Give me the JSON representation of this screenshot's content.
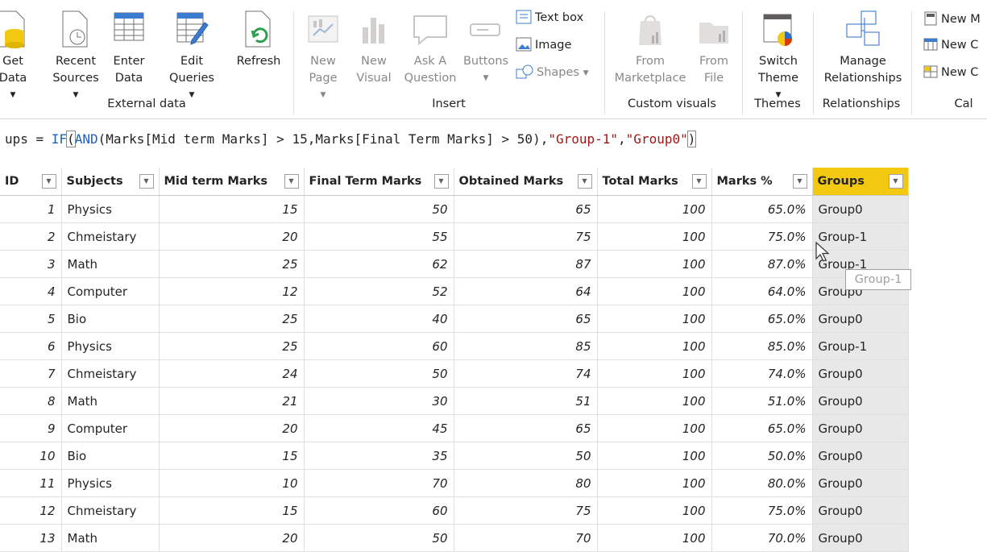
{
  "ribbon": {
    "external_data": {
      "group_label": "External data",
      "buttons": [
        {
          "line1": "Get",
          "line2": "Data"
        },
        {
          "line1": "Recent",
          "line2": "Sources"
        },
        {
          "line1": "Enter",
          "line2": "Data"
        },
        {
          "line1": "Edit",
          "line2": "Queries"
        },
        {
          "line1": "Refresh",
          "line2": ""
        }
      ]
    },
    "insert": {
      "group_label": "Insert",
      "buttons": [
        {
          "line1": "New",
          "line2": "Page"
        },
        {
          "line1": "New",
          "line2": "Visual"
        },
        {
          "line1": "Ask A",
          "line2": "Question"
        },
        {
          "line1": "Buttons",
          "line2": ""
        }
      ],
      "small": {
        "text_box": "Text box",
        "image": "Image",
        "shapes": "Shapes"
      }
    },
    "custom_visuals": {
      "group_label": "Custom visuals",
      "buttons": [
        {
          "line1": "From",
          "line2": "Marketplace"
        },
        {
          "line1": "From",
          "line2": "File"
        }
      ]
    },
    "themes": {
      "group_label": "Themes",
      "buttons": [
        {
          "line1": "Switch",
          "line2": "Theme"
        }
      ]
    },
    "relationships": {
      "group_label": "Relationships",
      "buttons": [
        {
          "line1": "Manage",
          "line2": "Relationships"
        }
      ]
    },
    "calculations": {
      "group_label": "Cal",
      "small": [
        "New M",
        "New C",
        "New C"
      ]
    }
  },
  "formula": {
    "prefix": "ups = ",
    "fn_if": "IF",
    "open_bracket": "(",
    "fn_and": "AND",
    "part1": "(Marks[Mid term Marks] > ",
    "num1": "15",
    "part2": ",Marks[Final Term Marks] > ",
    "num2": "50",
    "part3": "),",
    "str1": "\"Group-1\"",
    "comma": ",",
    "str2": "\"Group0\"",
    "close_bracket": ")"
  },
  "table": {
    "columns": [
      "ID",
      "Subjects",
      "Mid term Marks",
      "Final Term Marks",
      "Obtained Marks",
      "Total Marks",
      "Marks %",
      "Groups"
    ],
    "rows": [
      [
        "1",
        "Physics",
        "15",
        "50",
        "65",
        "100",
        "65.0%",
        "Group0"
      ],
      [
        "2",
        "Chmeistary",
        "20",
        "55",
        "75",
        "100",
        "75.0%",
        "Group-1"
      ],
      [
        "3",
        "Math",
        "25",
        "62",
        "87",
        "100",
        "87.0%",
        "Group-1"
      ],
      [
        "4",
        "Computer",
        "12",
        "52",
        "64",
        "100",
        "64.0%",
        "Group0"
      ],
      [
        "5",
        "Bio",
        "25",
        "40",
        "65",
        "100",
        "65.0%",
        "Group0"
      ],
      [
        "6",
        "Physics",
        "25",
        "60",
        "85",
        "100",
        "85.0%",
        "Group-1"
      ],
      [
        "7",
        "Chmeistary",
        "24",
        "50",
        "74",
        "100",
        "74.0%",
        "Group0"
      ],
      [
        "8",
        "Math",
        "21",
        "30",
        "51",
        "100",
        "51.0%",
        "Group0"
      ],
      [
        "9",
        "Computer",
        "20",
        "45",
        "65",
        "100",
        "65.0%",
        "Group0"
      ],
      [
        "10",
        "Bio",
        "15",
        "35",
        "50",
        "100",
        "50.0%",
        "Group0"
      ],
      [
        "11",
        "Physics",
        "10",
        "70",
        "80",
        "100",
        "80.0%",
        "Group0"
      ],
      [
        "12",
        "Chmeistary",
        "15",
        "60",
        "75",
        "100",
        "75.0%",
        "Group0"
      ],
      [
        "13",
        "Math",
        "20",
        "50",
        "70",
        "100",
        "70.0%",
        "Group0"
      ]
    ]
  },
  "tooltip": "Group-1",
  "colors": {
    "active_header": "#f2c811",
    "selected_column": "#e8e8e8",
    "function": "#1f5fbf",
    "string": "#a31515"
  }
}
